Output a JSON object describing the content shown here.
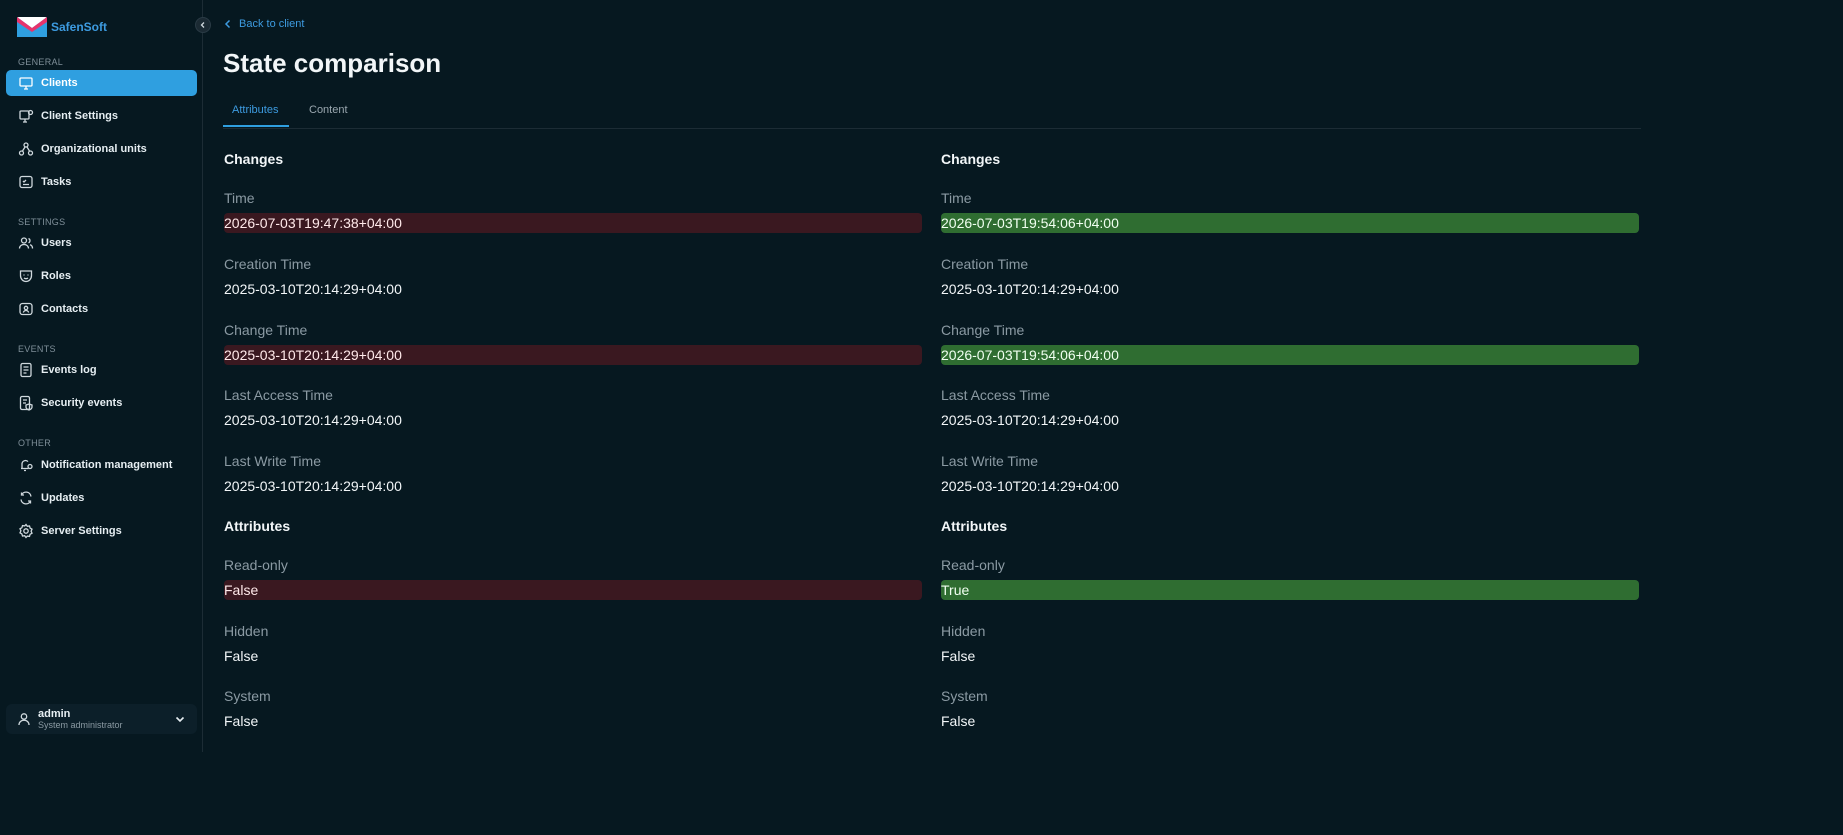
{
  "brand": {
    "name": "SafenSoft"
  },
  "sidebar": {
    "sections": {
      "general": "GENERAL",
      "settings": "SETTINGS",
      "events": "EVENTS",
      "other": "OTHER"
    },
    "items": [
      {
        "label": "Clients",
        "icon": "monitor-icon",
        "active": true
      },
      {
        "label": "Client Settings",
        "icon": "monitor-gear-icon"
      },
      {
        "label": "Organizational units",
        "icon": "org-tree-icon"
      },
      {
        "label": "Tasks",
        "icon": "tasks-icon"
      },
      {
        "label": "Users",
        "icon": "users-icon"
      },
      {
        "label": "Roles",
        "icon": "mask-icon"
      },
      {
        "label": "Contacts",
        "icon": "contacts-icon"
      },
      {
        "label": "Events log",
        "icon": "document-icon"
      },
      {
        "label": "Security events",
        "icon": "security-doc-icon"
      },
      {
        "label": "Notification management",
        "icon": "bell-gear-icon"
      },
      {
        "label": "Updates",
        "icon": "refresh-icon"
      },
      {
        "label": "Server Settings",
        "icon": "gear-icon"
      }
    ],
    "user": {
      "name": "admin",
      "role": "System administrator"
    }
  },
  "header": {
    "back_label": "Back to client",
    "title": "State comparison",
    "tabs": [
      {
        "label": "Attributes",
        "active": true
      },
      {
        "label": "Content",
        "active": false
      }
    ]
  },
  "left": {
    "changes_title": "Changes",
    "attributes_title": "Attributes",
    "fields": [
      {
        "label": "Time",
        "value": "2026-07-03T19:47:38+04:00",
        "state": "removed"
      },
      {
        "label": "Creation Time",
        "value": "2025-03-10T20:14:29+04:00",
        "state": "same"
      },
      {
        "label": "Change Time",
        "value": "2025-03-10T20:14:29+04:00",
        "state": "removed"
      },
      {
        "label": "Last Access Time",
        "value": "2025-03-10T20:14:29+04:00",
        "state": "same"
      },
      {
        "label": "Last Write Time",
        "value": "2025-03-10T20:14:29+04:00",
        "state": "same"
      }
    ],
    "attributes": [
      {
        "label": "Read-only",
        "value": "False",
        "state": "removed"
      },
      {
        "label": "Hidden",
        "value": "False",
        "state": "same"
      },
      {
        "label": "System",
        "value": "False",
        "state": "same"
      }
    ]
  },
  "right": {
    "changes_title": "Changes",
    "attributes_title": "Attributes",
    "fields": [
      {
        "label": "Time",
        "value": "2026-07-03T19:54:06+04:00",
        "state": "added"
      },
      {
        "label": "Creation Time",
        "value": "2025-03-10T20:14:29+04:00",
        "state": "same"
      },
      {
        "label": "Change Time",
        "value": "2026-07-03T19:54:06+04:00",
        "state": "added"
      },
      {
        "label": "Last Access Time",
        "value": "2025-03-10T20:14:29+04:00",
        "state": "same"
      },
      {
        "label": "Last Write Time",
        "value": "2025-03-10T20:14:29+04:00",
        "state": "same"
      }
    ],
    "attributes": [
      {
        "label": "Read-only",
        "value": "True",
        "state": "added"
      },
      {
        "label": "Hidden",
        "value": "False",
        "state": "same"
      },
      {
        "label": "System",
        "value": "False",
        "state": "same"
      }
    ]
  },
  "colors": {
    "accent": "#2f9fe0",
    "removed_bg": "#3a1820",
    "added_bg": "#2f6d31",
    "background": "#061820"
  }
}
